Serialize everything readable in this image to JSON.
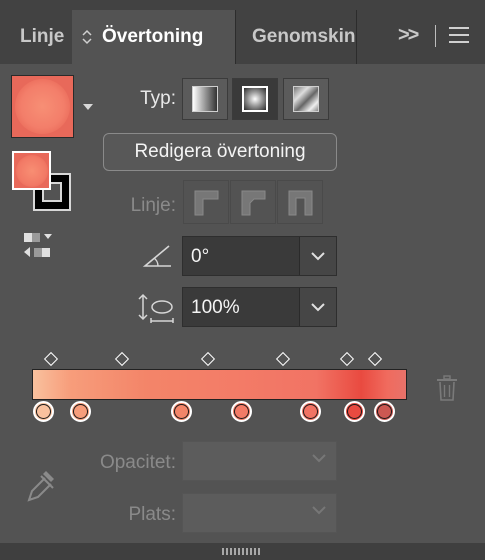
{
  "tabs": [
    {
      "label": "Linje"
    },
    {
      "label": "Övertoning"
    },
    {
      "label": "Genomskinlighet"
    }
  ],
  "overflow": ">>",
  "typ": {
    "label": "Typ:",
    "options": [
      "linear",
      "radial",
      "freeform"
    ],
    "selected": "radial"
  },
  "edit_gradient_label": "Redigera övertoning",
  "stroke_row": {
    "label": "Linje:"
  },
  "angle": {
    "value": "0°"
  },
  "aspect_ratio": {
    "value": "100%"
  },
  "gradient": {
    "stops": [
      {
        "pos": 0.0,
        "color": "#f9c19e"
      },
      {
        "pos": 0.105,
        "color": "#f79d7b"
      },
      {
        "pos": 0.39,
        "color": "#f38569"
      },
      {
        "pos": 0.56,
        "color": "#f37b67"
      },
      {
        "pos": 0.755,
        "color": "#f17364"
      },
      {
        "pos": 0.88,
        "color": "#e94a40"
      },
      {
        "pos": 0.965,
        "color": "#cc5852"
      }
    ],
    "midpoints": [
      0.05,
      0.24,
      0.47,
      0.67,
      0.84,
      0.915
    ]
  },
  "opacity": {
    "label": "Opacitet:",
    "value": ""
  },
  "position": {
    "label": "Plats:",
    "value": ""
  },
  "colors": {
    "panel_bg": "#535353",
    "tab_bar_bg": "#424242",
    "fill": "#f37e6a"
  }
}
